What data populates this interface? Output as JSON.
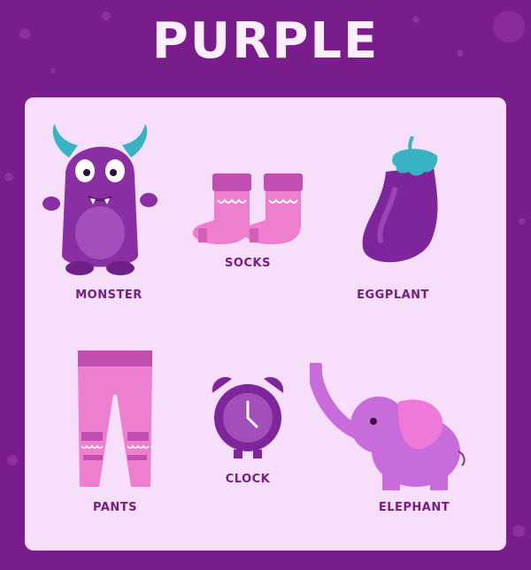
{
  "title": "PURPLE",
  "items": [
    {
      "label": "MONSTER",
      "icon": "monster-icon"
    },
    {
      "label": "SOCKS",
      "icon": "socks-icon"
    },
    {
      "label": "EGGPLANT",
      "icon": "eggplant-icon"
    },
    {
      "label": "PANTS",
      "icon": "pants-icon"
    },
    {
      "label": "CLOCK",
      "icon": "clock-icon"
    },
    {
      "label": "ELEPHANT",
      "icon": "elephant-icon"
    }
  ],
  "colors": {
    "background": "#7a1d8c",
    "card": "#f7defb",
    "label": "#7b1b86",
    "title": "#fbeefd"
  }
}
